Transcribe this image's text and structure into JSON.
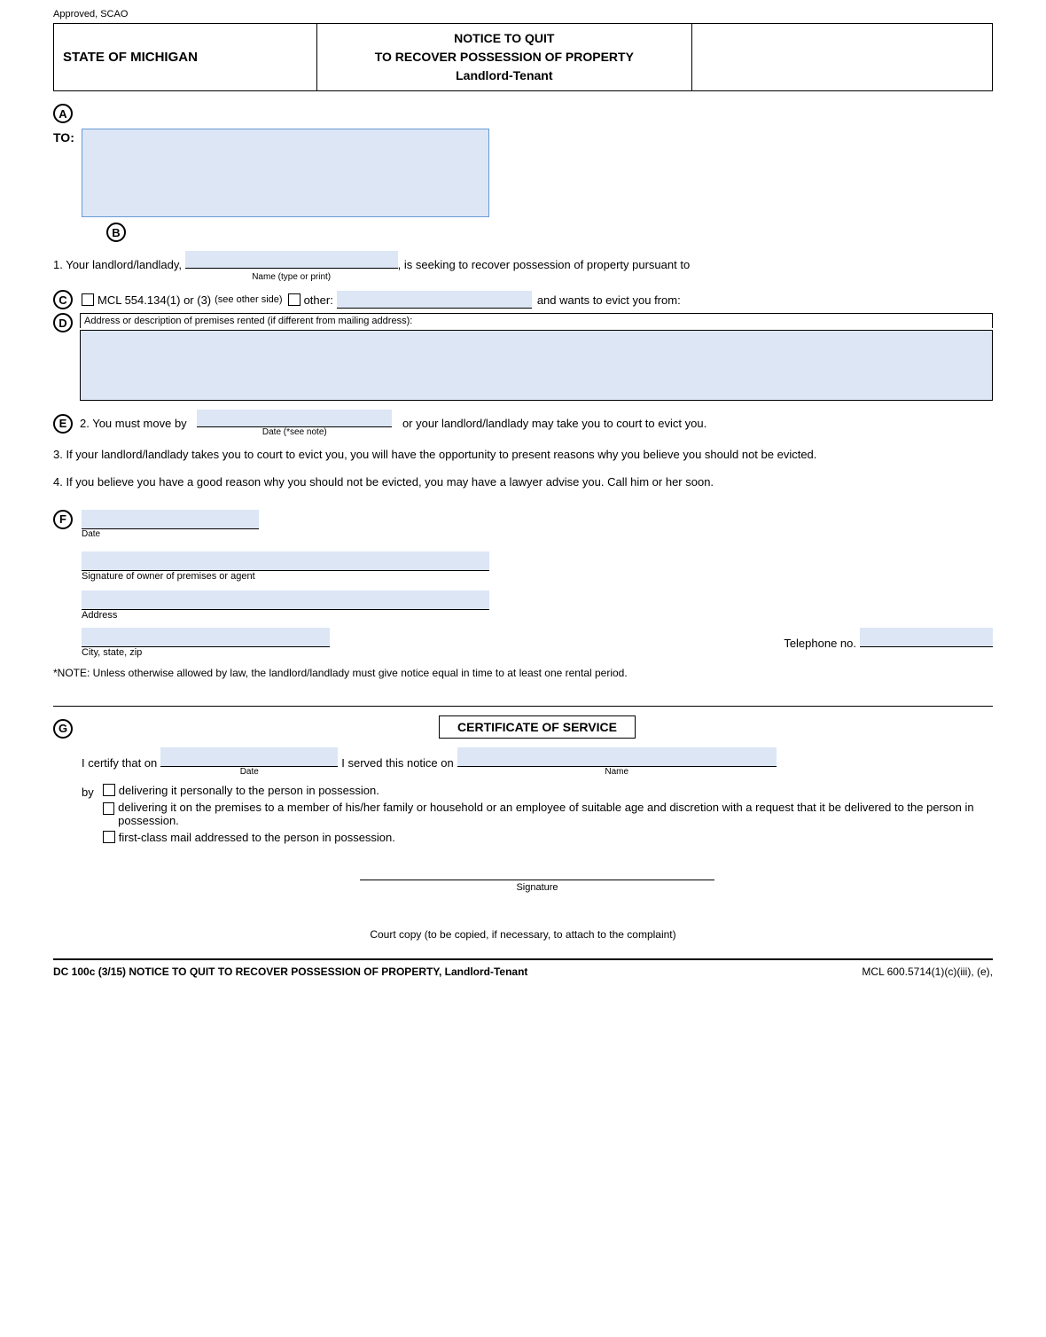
{
  "approved": "Approved, SCAO",
  "state": "STATE OF MICHIGAN",
  "title_line1": "NOTICE TO QUIT",
  "title_line2": "TO RECOVER POSSESSION OF PROPERTY",
  "title_line3": "Landlord-Tenant",
  "to_label": "TO:",
  "section1_prefix": "1.  Your landlord/landlady,",
  "section1_name_label": "Name (type or print)",
  "section1_suffix": ", is seeking to recover possession of property pursuant to",
  "section_c_mcl": "MCL 554.134(1) or (3)",
  "section_c_see": "(see other side)",
  "section_c_other": "other:",
  "section_c_and": "and wants to evict you from:",
  "section_d_label": "Address or description of premises rented (if different from mailing address):",
  "section2_prefix": "2.  You must move by",
  "section2_date_label": "Date (*see note)",
  "section2_suffix": "or your landlord/landlady may take you to court to evict you.",
  "section3": "3.  If your landlord/landlady takes you to court to evict you, you will have the opportunity to present reasons why you believe you should not be evicted.",
  "section4": "4.  If you believe you have a good reason why you should not be evicted, you may have a lawyer advise you.  Call him or her soon.",
  "date_label": "Date",
  "sig_owner_label": "Signature of owner of premises or agent",
  "address_label": "Address",
  "city_label": "City, state, zip",
  "telephone_label": "Telephone no.",
  "note_text": "*NOTE:  Unless otherwise allowed by law, the landlord/landlady must give notice equal in time to at least one rental period.",
  "certificate_title": "CERTIFICATE OF SERVICE",
  "certify_prefix": "I certify that on",
  "certify_date_label": "Date",
  "certify_middle": "I served this notice on",
  "certify_name_label": "Name",
  "by_label": "by",
  "delivery1": "delivering it personally to the person in possession.",
  "delivery2": "delivering it on the premises to a member of his/her family or household or an employee of suitable age and discretion with a request that it be delivered to the person in possession.",
  "delivery3": "first-class mail addressed to the person in possession.",
  "signature_label": "Signature",
  "court_copy": "Court copy (to be copied, if necessary, to attach to the complaint)",
  "footer_left": "DC 100c  (3/15)  NOTICE TO QUIT TO RECOVER POSSESSION OF PROPERTY, Landlord-Tenant",
  "footer_right": "MCL 600.5714(1)(c)(iii), (e),",
  "circle_a": "A",
  "circle_b": "B",
  "circle_c": "C",
  "circle_d": "D",
  "circle_e": "E",
  "circle_f": "F",
  "circle_g": "G"
}
